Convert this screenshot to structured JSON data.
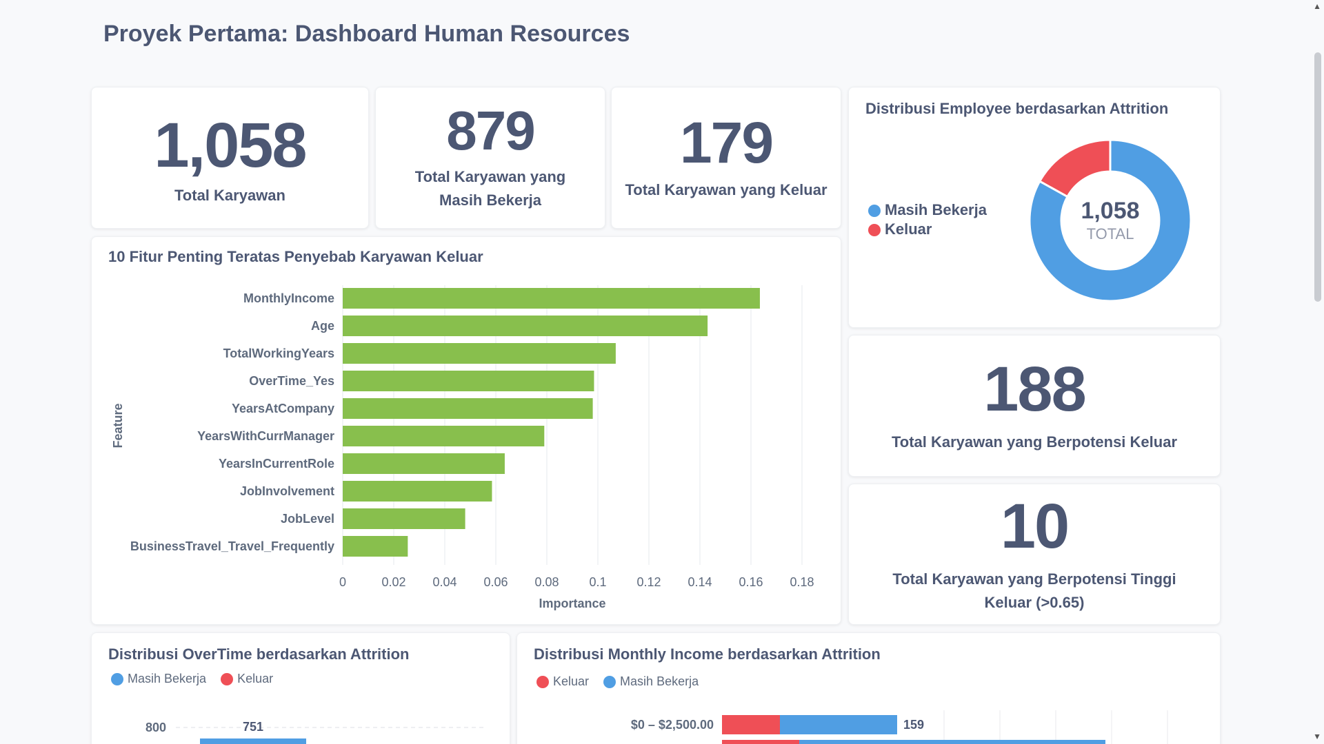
{
  "page": {
    "title": "Proyek Pertama: Dashboard Human Resources"
  },
  "colors": {
    "blue": "#509ee3",
    "red": "#ef4f56",
    "green": "#88bf4d",
    "text": "#4c5773",
    "axis": "#5e6a7d"
  },
  "kpis": {
    "total": {
      "value": "1,058",
      "label": "Total Karyawan"
    },
    "active": {
      "value": "879",
      "label": "Total Karyawan yang Masih Bekerja"
    },
    "left": {
      "value": "179",
      "label": "Total Karyawan yang Keluar"
    },
    "potential": {
      "value": "188",
      "label": "Total Karyawan yang Berpotensi Keluar"
    },
    "high_potential": {
      "value": "10",
      "label": "Total Karyawan yang Berpotensi Tinggi Keluar (>0.65)"
    }
  },
  "donut_card": {
    "title": "Distribusi Employee berdasarkan Attrition",
    "legend": [
      "Masih Bekerja",
      "Keluar"
    ],
    "center_value": "1,058",
    "center_label": "TOTAL"
  },
  "overtime_card": {
    "title": "Distribusi OverTime berdasarkan Attrition",
    "legend": [
      "Masih Bekerja",
      "Keluar"
    ]
  },
  "income_card": {
    "title": "Distribusi Monthly Income berdasarkan Attrition",
    "legend": [
      "Keluar",
      "Masih Bekerja"
    ]
  },
  "features_card": {
    "title": "10 Fitur Penting Teratas Penyebab Karyawan Keluar"
  },
  "chart_data": [
    {
      "type": "bar",
      "orientation": "horizontal",
      "title": "10 Fitur Penting Teratas Penyebab Karyawan Keluar",
      "xlabel": "Importance",
      "ylabel": "Feature",
      "categories": [
        "MonthlyIncome",
        "Age",
        "TotalWorkingYears",
        "OverTime_Yes",
        "YearsAtCompany",
        "YearsWithCurrManager",
        "YearsInCurrentRole",
        "JobInvolvement",
        "JobLevel",
        "BusinessTravel_Travel_Frequently"
      ],
      "values": [
        0.1635,
        0.143,
        0.107,
        0.0985,
        0.098,
        0.079,
        0.0635,
        0.0585,
        0.048,
        0.0255
      ],
      "xlim": [
        0,
        0.18
      ],
      "xticks": [
        "0",
        "0.02",
        "0.04",
        "0.06",
        "0.08",
        "0.1",
        "0.12",
        "0.14",
        "0.16",
        "0.18"
      ],
      "grid": true
    },
    {
      "type": "pie",
      "title": "Distribusi Employee berdasarkan Attrition",
      "categories": [
        "Masih Bekerja",
        "Keluar"
      ],
      "values": [
        879,
        179
      ],
      "total": "1,058",
      "legend": "left"
    },
    {
      "type": "bar",
      "title": "Distribusi OverTime berdasarkan Attrition",
      "series": [
        {
          "name": "Masih Bekerja",
          "values": [
            751
          ]
        },
        {
          "name": "Keluar",
          "values": []
        }
      ],
      "yticks": [
        "800"
      ],
      "data_labels": [
        "751"
      ]
    },
    {
      "type": "bar",
      "orientation": "horizontal",
      "stacked": true,
      "title": "Distribusi Monthly Income berdasarkan Attrition",
      "categories": [
        "$0 – $2,500.00"
      ],
      "series": [
        {
          "name": "Keluar",
          "values": []
        },
        {
          "name": "Masih Bekerja",
          "values": []
        }
      ],
      "totals": [
        "159"
      ]
    }
  ]
}
